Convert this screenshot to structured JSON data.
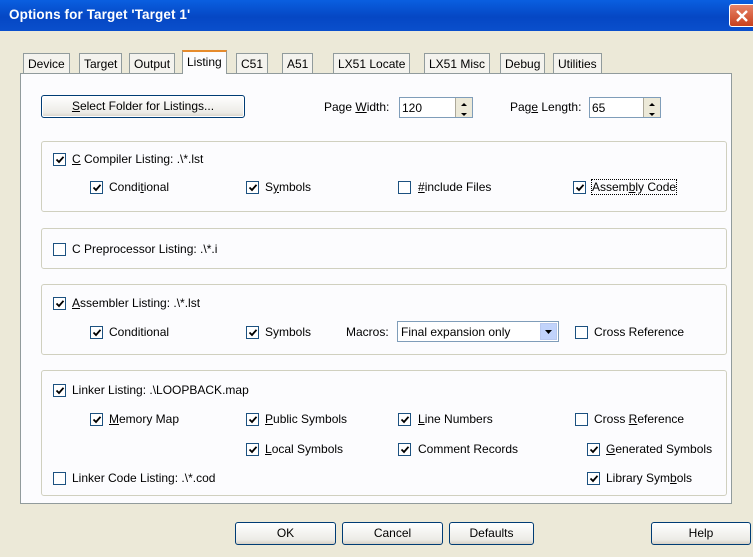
{
  "window": {
    "title": "Options for Target 'Target 1'"
  },
  "tabs": [
    {
      "label": "Device"
    },
    {
      "label": "Target"
    },
    {
      "label": "Output"
    },
    {
      "label": "Listing"
    },
    {
      "label": "C51"
    },
    {
      "label": "A51"
    },
    {
      "label": "LX51 Locate"
    },
    {
      "label": "LX51 Misc"
    },
    {
      "label": "Debug"
    },
    {
      "label": "Utilities"
    }
  ],
  "active_tab": "Listing",
  "top": {
    "select_folder": {
      "pre": "",
      "u": "S",
      "post": "elect Folder for Listings..."
    },
    "page_width": {
      "pre": "Page ",
      "u": "W",
      "post": "idth:",
      "value": "120"
    },
    "page_length": {
      "pre": "Pag",
      "u": "e",
      "post": " Length:",
      "value": "65"
    }
  },
  "c_compiler": {
    "listing": {
      "pre": "",
      "u": "C",
      "post": " Compiler Listing:  .\\*.lst",
      "checked": true
    },
    "conditional": {
      "pre": "Condi",
      "u": "t",
      "post": "ional",
      "checked": true
    },
    "symbols": {
      "pre": "S",
      "u": "y",
      "post": "mbols",
      "checked": true
    },
    "include": {
      "pre": "",
      "u": "#",
      "post": "include Files",
      "checked": false
    },
    "assembly": {
      "pre": "Assem",
      "u": "b",
      "post": "ly Code",
      "checked": true
    }
  },
  "c_preprocessor": {
    "listing": {
      "pre": "C Preprocessor Listing:  .\\*.i",
      "u": "",
      "post": "",
      "checked": false
    }
  },
  "assembler": {
    "listing": {
      "pre": "",
      "u": "A",
      "post": "ssembler Listing:  .\\*.lst",
      "checked": true
    },
    "conditional": {
      "pre": "Conditional",
      "u": "",
      "post": "",
      "checked": true
    },
    "symbols": {
      "pre": "Symbols",
      "u": "",
      "post": "",
      "checked": true
    },
    "macros_label": {
      "pre": "Macros:",
      "u": "",
      "post": ""
    },
    "macros_value": "Final expansion only",
    "cross_ref": {
      "pre": "Cross Reference",
      "u": "",
      "post": "",
      "checked": false
    }
  },
  "linker": {
    "listing": {
      "pre": "Linker Listing:  .\\LOOPBACK.map",
      "u": "",
      "post": "",
      "checked": true
    },
    "memory_map": {
      "pre": "",
      "u": "M",
      "post": "emory Map",
      "checked": true
    },
    "public_symbols": {
      "pre": "",
      "u": "P",
      "post": "ublic Symbols",
      "checked": true
    },
    "line_numbers": {
      "pre": "",
      "u": "L",
      "post": "ine Numbers",
      "checked": true
    },
    "cross_ref": {
      "pre": "Cross ",
      "u": "R",
      "post": "eference",
      "checked": false
    },
    "local_symbols": {
      "pre": "",
      "u": "L",
      "post": "ocal Symbols",
      "checked": true
    },
    "comment_records": {
      "pre": "Comment Records",
      "u": "",
      "post": "",
      "checked": true
    },
    "generated_symbols": {
      "pre": "",
      "u": "G",
      "post": "enerated Symbols",
      "checked": true
    },
    "code_listing": {
      "pre": "Linker Code Listing:  .\\*.cod",
      "u": "",
      "post": "",
      "checked": false
    },
    "library_symbols": {
      "pre": "Library Sym",
      "u": "b",
      "post": "ols",
      "checked": true
    }
  },
  "bottom": {
    "ok": "OK",
    "cancel": "Cancel",
    "defaults": "Defaults",
    "help": "Help"
  },
  "colors": {
    "titlebar": "#0A4FCC",
    "dialog_bg": "#ECE9D8",
    "active_tab_accent": "#E68B2C",
    "check_mark": "#21A121"
  }
}
